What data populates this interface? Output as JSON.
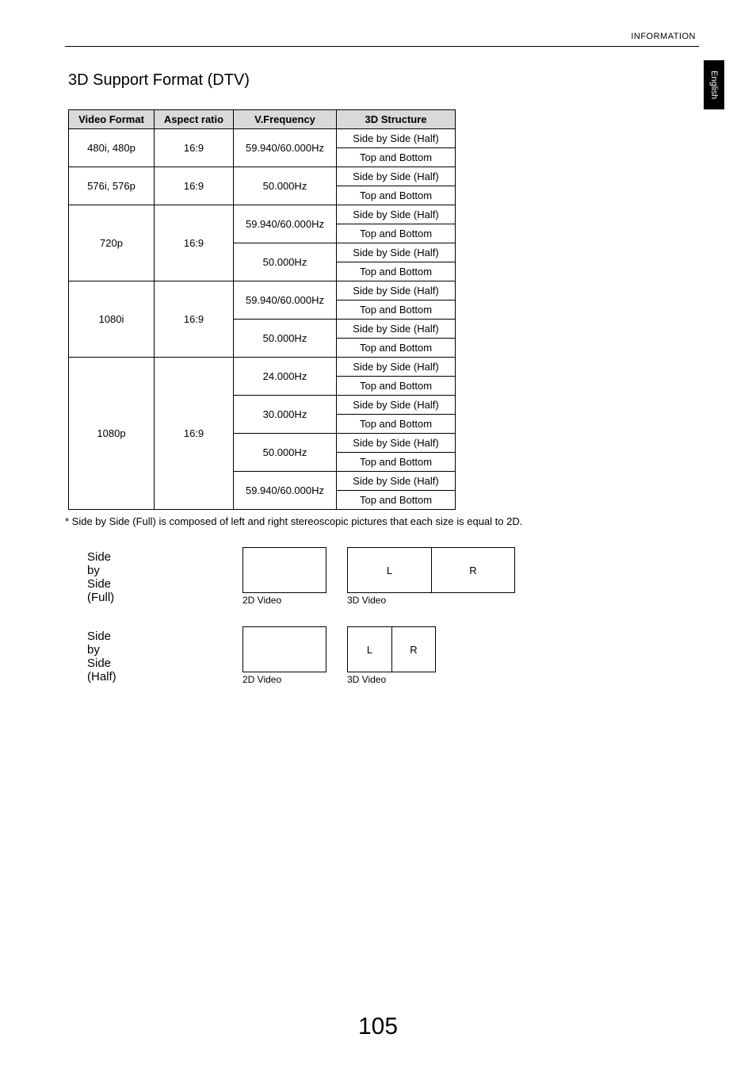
{
  "header": {
    "section": "INFORMATION",
    "language": "English"
  },
  "title": "3D Support Format (DTV)",
  "table": {
    "headers": [
      "Video Format",
      "Aspect ratio",
      "V.Frequency",
      "3D Structure"
    ],
    "groups": [
      {
        "format": "480i, 480p",
        "aspect": "16:9",
        "freqs": [
          {
            "freq": "59.940/60.000Hz",
            "structures": [
              "Side by Side (Half)",
              "Top and Bottom"
            ]
          }
        ]
      },
      {
        "format": "576i, 576p",
        "aspect": "16:9",
        "freqs": [
          {
            "freq": "50.000Hz",
            "structures": [
              "Side by Side (Half)",
              "Top and Bottom"
            ]
          }
        ]
      },
      {
        "format": "720p",
        "aspect": "16:9",
        "freqs": [
          {
            "freq": "59.940/60.000Hz",
            "structures": [
              "Side by Side (Half)",
              "Top and Bottom"
            ]
          },
          {
            "freq": "50.000Hz",
            "structures": [
              "Side by Side (Half)",
              "Top and Bottom"
            ]
          }
        ]
      },
      {
        "format": "1080i",
        "aspect": "16:9",
        "freqs": [
          {
            "freq": "59.940/60.000Hz",
            "structures": [
              "Side by Side (Half)",
              "Top and Bottom"
            ]
          },
          {
            "freq": "50.000Hz",
            "structures": [
              "Side by Side (Half)",
              "Top and Bottom"
            ]
          }
        ]
      },
      {
        "format": "1080p",
        "aspect": "16:9",
        "freqs": [
          {
            "freq": "24.000Hz",
            "structures": [
              "Side by Side (Half)",
              "Top and Bottom"
            ]
          },
          {
            "freq": "30.000Hz",
            "structures": [
              "Side by Side (Half)",
              "Top and Bottom"
            ]
          },
          {
            "freq": "50.000Hz",
            "structures": [
              "Side by Side (Half)",
              "Top and Bottom"
            ]
          },
          {
            "freq": "59.940/60.000Hz",
            "structures": [
              "Side by Side (Half)",
              "Top and Bottom"
            ]
          }
        ]
      }
    ]
  },
  "footnote": "*  Side by Side (Full) is composed of left and right stereoscopic pictures that each size is equal to 2D.",
  "diagrams": {
    "full": {
      "title": "Side by Side (Full)",
      "label_2d": "2D Video",
      "label_3d": "3D Video",
      "l": "L",
      "r": "R"
    },
    "half": {
      "title": "Side by Side (Half)",
      "label_2d": "2D Video",
      "label_3d": "3D Video",
      "l": "L",
      "r": "R"
    }
  },
  "page_number": "105"
}
